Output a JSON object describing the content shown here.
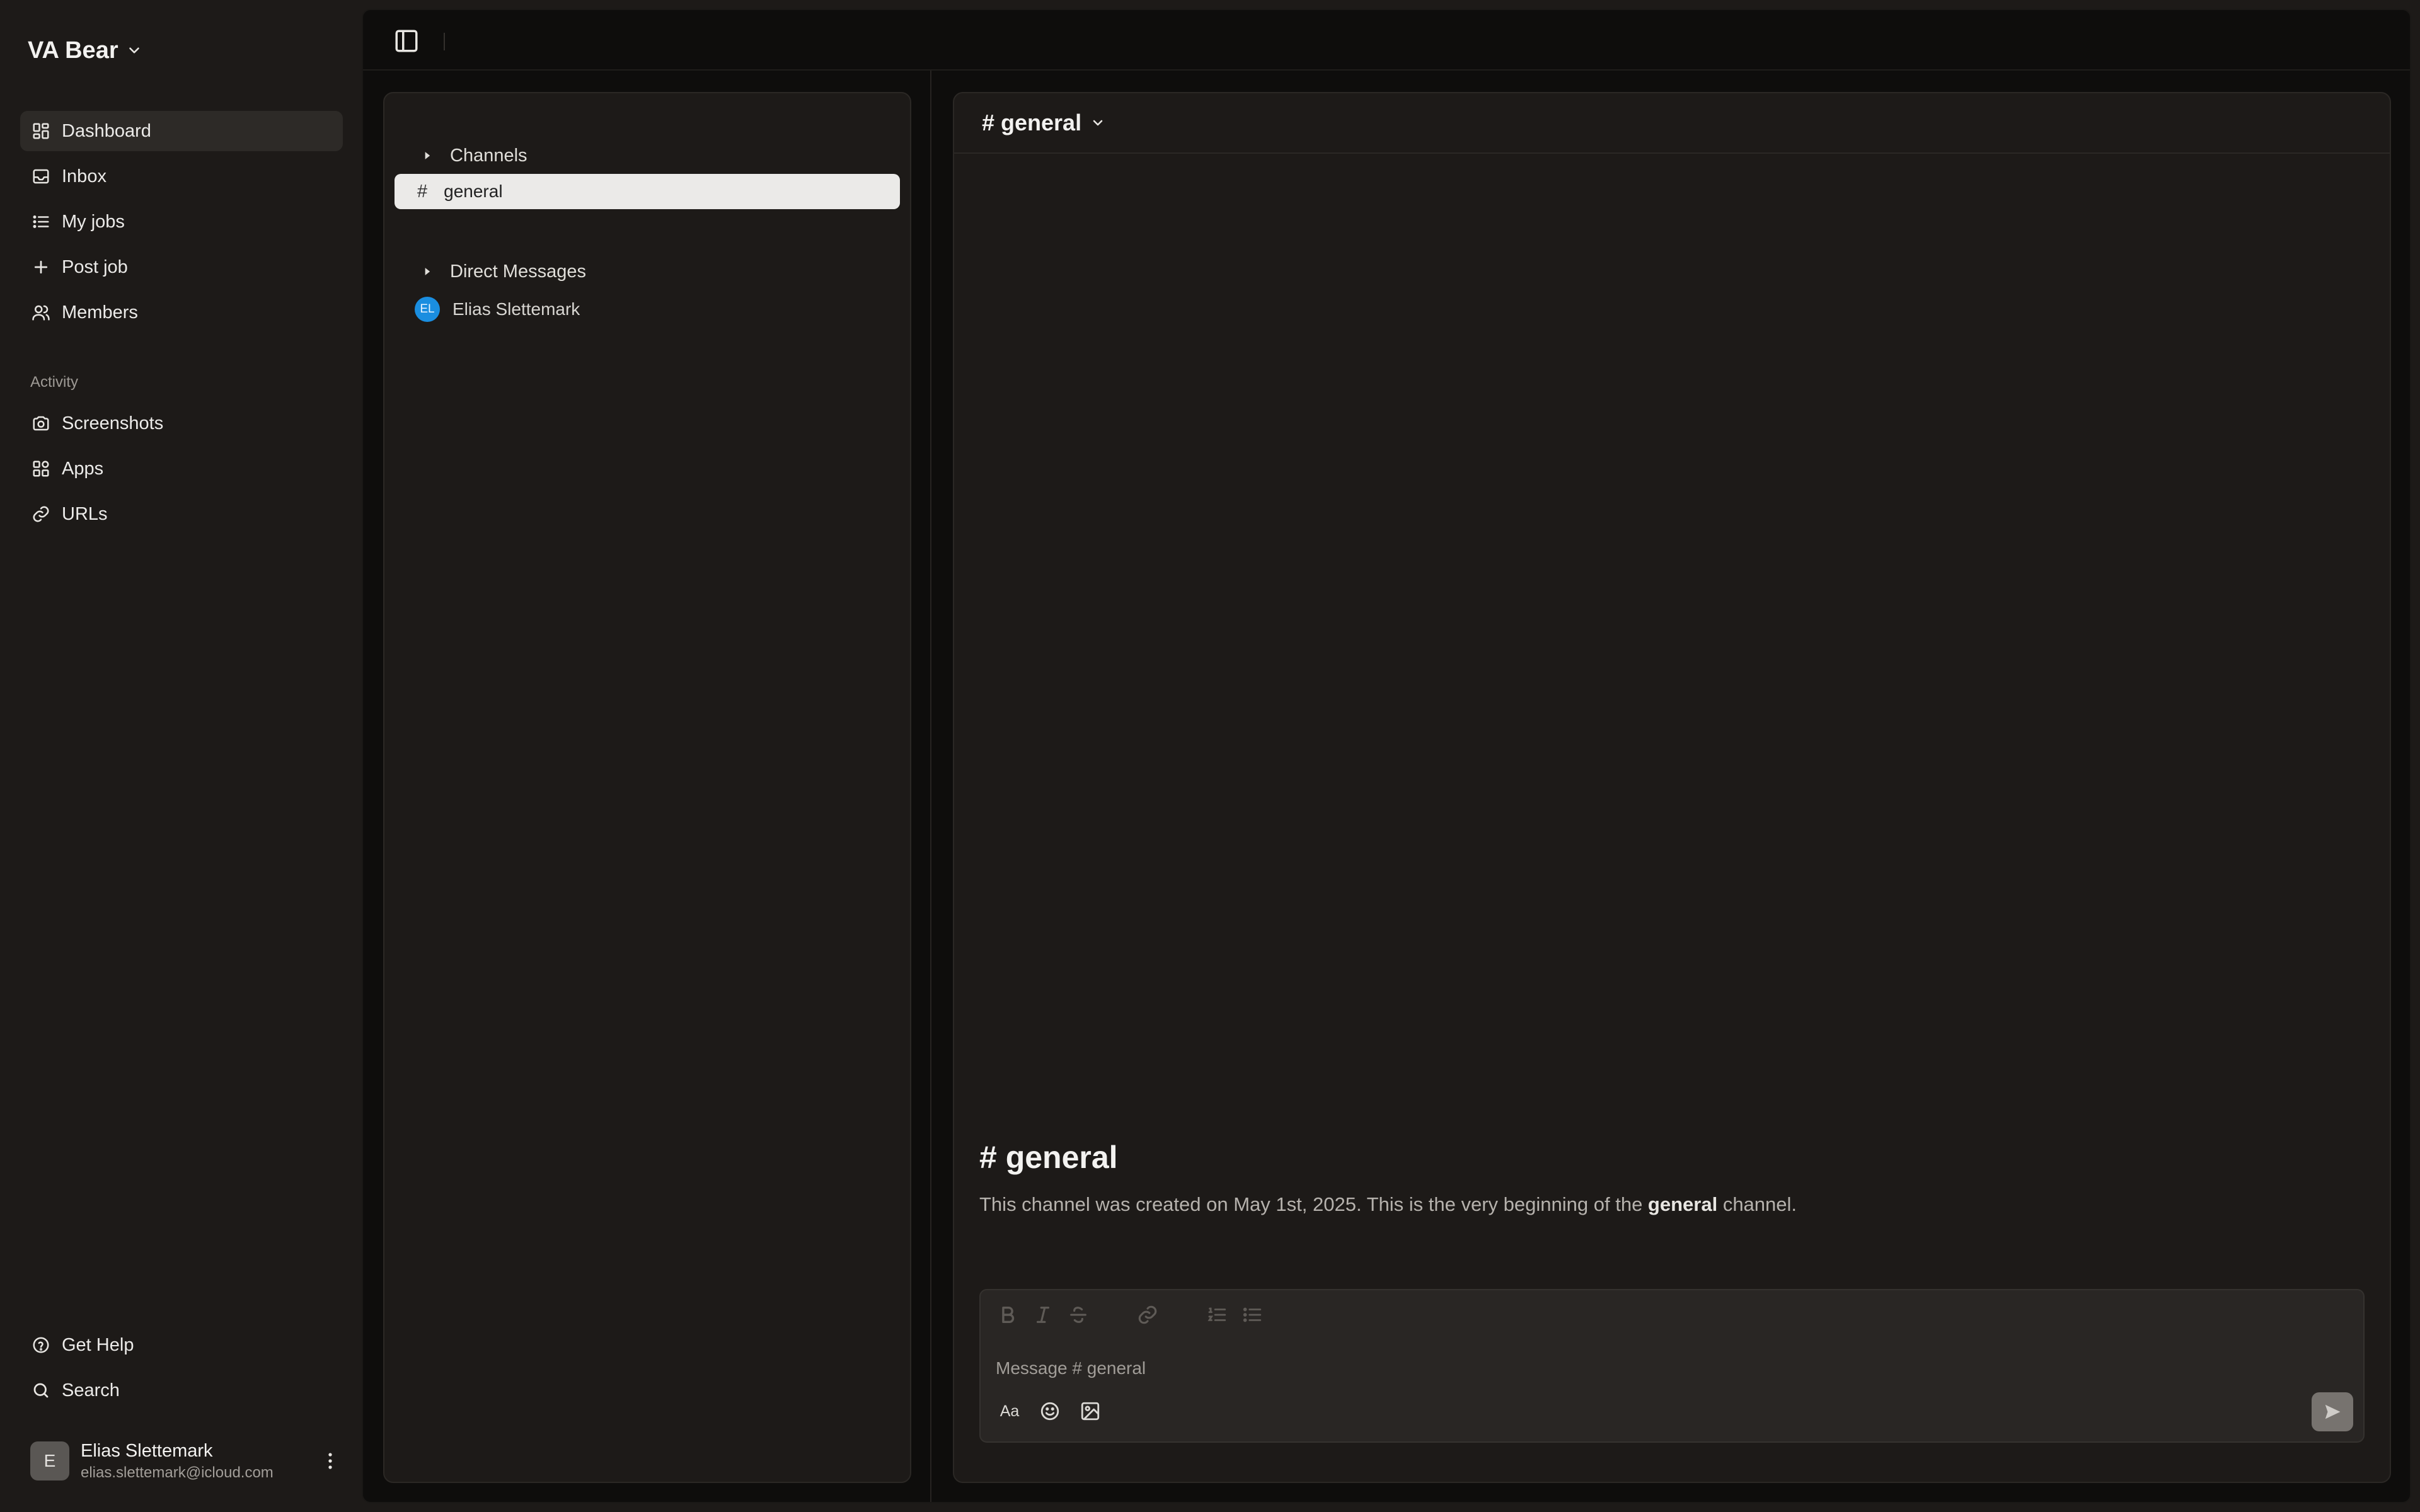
{
  "workspace": {
    "name": "VA Bear",
    "icon": "chevron-down-icon"
  },
  "nav": {
    "primary": [
      {
        "label": "Dashboard",
        "icon": "dashboard-icon",
        "active": true
      },
      {
        "label": "Inbox",
        "icon": "inbox-icon"
      },
      {
        "label": "My jobs",
        "icon": "list-icon"
      },
      {
        "label": "Post job",
        "icon": "plus-icon"
      },
      {
        "label": "Members",
        "icon": "users-icon"
      }
    ],
    "activity_label": "Activity",
    "activity": [
      {
        "label": "Screenshots",
        "icon": "camera-icon"
      },
      {
        "label": "Apps",
        "icon": "apps-icon"
      },
      {
        "label": "URLs",
        "icon": "link-icon"
      }
    ],
    "footer": [
      {
        "label": "Get Help",
        "icon": "help-icon"
      },
      {
        "label": "Search",
        "icon": "search-icon"
      }
    ]
  },
  "user": {
    "initial": "E",
    "name": "Elias Slettemark",
    "email": "elias.slettemark@icloud.com"
  },
  "channels_panel": {
    "channels_header": "Channels",
    "channels": [
      {
        "hash": "#",
        "name": "general",
        "selected": true
      }
    ],
    "dm_header": "Direct Messages",
    "dms": [
      {
        "initials": "EL",
        "name": "Elias Slettemark",
        "color": "#1a8ee0"
      }
    ]
  },
  "chat": {
    "header_title": "# general",
    "intro_title": "# general",
    "intro_text_before": "This channel was created on May 1st, 2025. This is the very beginning of the ",
    "intro_text_bold": "general",
    "intro_text_after": " channel.",
    "composer": {
      "placeholder": "Message # general",
      "value": "",
      "format_tools": [
        "bold-icon",
        "italic-icon",
        "strikethrough-icon",
        "link-icon",
        "ordered-list-icon",
        "bullet-list-icon"
      ],
      "bottom_tools": [
        "text-format-icon",
        "emoji-icon",
        "image-icon"
      ],
      "send_icon": "send-icon",
      "text_format_label": "Aa"
    }
  }
}
